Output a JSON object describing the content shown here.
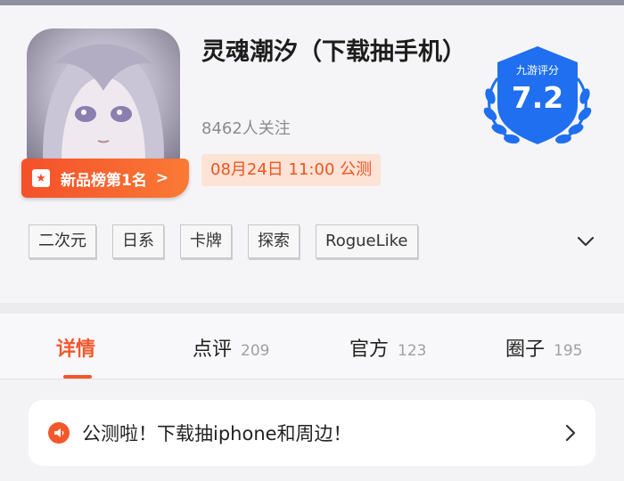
{
  "game": {
    "title": "灵魂潮汐（下载抽手机）",
    "followers": "8462人关注",
    "release_time": "08月24日 11:00 公测",
    "rank_badge": "新品榜第1名",
    "rank_arrow": ">",
    "icon": "anime-girl-game-icon"
  },
  "score": {
    "label": "九游评分",
    "value": "7.2",
    "color": "#1f6ff0"
  },
  "tags": [
    "二次元",
    "日系",
    "卡牌",
    "探索",
    "RogueLike"
  ],
  "tabs": [
    {
      "label": "详情",
      "count": ""
    },
    {
      "label": "点评",
      "count": "209"
    },
    {
      "label": "官方",
      "count": "123"
    },
    {
      "label": "圈子",
      "count": "195"
    }
  ],
  "notice": {
    "text": "公测啦！下载抽iphone和周边！"
  },
  "colors": {
    "accent": "#f4572b",
    "rank_badge": "#f4502a",
    "release_bg": "#fde3d6"
  }
}
